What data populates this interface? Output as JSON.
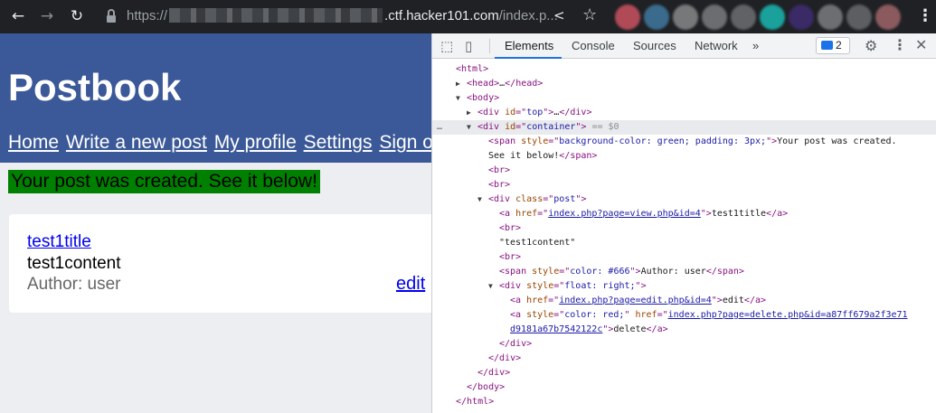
{
  "browser": {
    "url_prefix": "https://",
    "url_host": ".ctf.hacker101.com",
    "url_path": "/index.p..."
  },
  "page": {
    "site_title": "Postbook",
    "nav": [
      "Home",
      "Write a new post",
      "My profile",
      "Settings",
      "Sign out"
    ],
    "flash": "Your post was created. See it below!",
    "post": {
      "title": "test1title",
      "content": "test1content",
      "author": "Author: user",
      "edit": "edit"
    }
  },
  "devtools": {
    "tabs": [
      "Elements",
      "Console",
      "Sources",
      "Network"
    ],
    "active_tab": "Elements",
    "more_tabs": "»",
    "issues_count": "2",
    "selected_marker": "== $0",
    "dom": [
      {
        "indent": 0,
        "tri": "",
        "parts": [
          [
            "t",
            "<html>"
          ]
        ]
      },
      {
        "indent": 1,
        "tri": "▶",
        "parts": [
          [
            "t",
            "<head>"
          ],
          [
            "x",
            "…"
          ],
          [
            "t",
            "</head>"
          ]
        ]
      },
      {
        "indent": 1,
        "tri": "▼",
        "parts": [
          [
            "t",
            "<body>"
          ]
        ]
      },
      {
        "indent": 2,
        "tri": "▶",
        "parts": [
          [
            "t",
            "<div "
          ],
          [
            "an",
            "id"
          ],
          [
            "t",
            "=\""
          ],
          [
            "av",
            "top"
          ],
          [
            "t",
            "\">"
          ],
          [
            "x",
            "…"
          ],
          [
            "t",
            "</div>"
          ]
        ]
      },
      {
        "indent": 2,
        "tri": "▼",
        "sel": true,
        "parts": [
          [
            "t",
            "<div "
          ],
          [
            "an",
            "id"
          ],
          [
            "t",
            "=\""
          ],
          [
            "av",
            "container"
          ],
          [
            "t",
            "\">"
          ],
          [
            "eq",
            " == $0"
          ]
        ]
      },
      {
        "indent": 3,
        "tri": "",
        "parts": [
          [
            "t",
            "<span "
          ],
          [
            "an",
            "style"
          ],
          [
            "t",
            "=\""
          ],
          [
            "av",
            "background-color: green; padding: 3px;"
          ],
          [
            "t",
            "\">"
          ],
          [
            "x",
            "Your post was created."
          ]
        ]
      },
      {
        "indent": 3,
        "tri": "",
        "parts": [
          [
            "x",
            "See it below!"
          ],
          [
            "t",
            "</span>"
          ]
        ]
      },
      {
        "indent": 3,
        "tri": "",
        "parts": [
          [
            "t",
            "<br>"
          ]
        ]
      },
      {
        "indent": 3,
        "tri": "",
        "parts": [
          [
            "t",
            "<br>"
          ]
        ]
      },
      {
        "indent": 3,
        "tri": "▼",
        "parts": [
          [
            "t",
            "<div "
          ],
          [
            "an",
            "class"
          ],
          [
            "t",
            "=\""
          ],
          [
            "av",
            "post"
          ],
          [
            "t",
            "\">"
          ]
        ]
      },
      {
        "indent": 4,
        "tri": "",
        "parts": [
          [
            "t",
            "<a "
          ],
          [
            "an",
            "href"
          ],
          [
            "t",
            "=\""
          ],
          [
            "lnk",
            "index.php?page=view.php&id=4"
          ],
          [
            "t",
            "\">"
          ],
          [
            "x",
            "test1title"
          ],
          [
            "t",
            "</a>"
          ]
        ]
      },
      {
        "indent": 4,
        "tri": "",
        "parts": [
          [
            "t",
            "<br>"
          ]
        ]
      },
      {
        "indent": 4,
        "tri": "",
        "parts": [
          [
            "x",
            "\"test1content\""
          ]
        ]
      },
      {
        "indent": 4,
        "tri": "",
        "parts": [
          [
            "t",
            "<br>"
          ]
        ]
      },
      {
        "indent": 4,
        "tri": "",
        "parts": [
          [
            "t",
            "<span "
          ],
          [
            "an",
            "style"
          ],
          [
            "t",
            "=\""
          ],
          [
            "av",
            "color: #666"
          ],
          [
            "t",
            "\">"
          ],
          [
            "x",
            "Author: user"
          ],
          [
            "t",
            "</span>"
          ]
        ]
      },
      {
        "indent": 4,
        "tri": "▼",
        "parts": [
          [
            "t",
            "<div "
          ],
          [
            "an",
            "style"
          ],
          [
            "t",
            "=\""
          ],
          [
            "av",
            "float: right;"
          ],
          [
            "t",
            "\">"
          ]
        ]
      },
      {
        "indent": 5,
        "tri": "",
        "parts": [
          [
            "t",
            "<a "
          ],
          [
            "an",
            "href"
          ],
          [
            "t",
            "=\""
          ],
          [
            "lnk",
            "index.php?page=edit.php&id=4"
          ],
          [
            "t",
            "\">"
          ],
          [
            "x",
            "edit"
          ],
          [
            "t",
            "</a>"
          ]
        ]
      },
      {
        "indent": 5,
        "tri": "",
        "parts": [
          [
            "t",
            "<a "
          ],
          [
            "an",
            "style"
          ],
          [
            "t",
            "=\""
          ],
          [
            "av",
            "color: red;"
          ],
          [
            "t",
            "\" "
          ],
          [
            "an",
            "href"
          ],
          [
            "t",
            "=\""
          ],
          [
            "lnk",
            "index.php?page=delete.php&id=a87ff679a2f3e71"
          ]
        ]
      },
      {
        "indent": 5,
        "tri": "",
        "parts": [
          [
            "lnk",
            "d9181a67b7542122c"
          ],
          [
            "t",
            "\">"
          ],
          [
            "x",
            "delete"
          ],
          [
            "t",
            "</a>"
          ]
        ]
      },
      {
        "indent": 4,
        "tri": "",
        "parts": [
          [
            "t",
            "</div>"
          ]
        ]
      },
      {
        "indent": 3,
        "tri": "",
        "parts": [
          [
            "t",
            "</div>"
          ]
        ]
      },
      {
        "indent": 2,
        "tri": "",
        "parts": [
          [
            "t",
            "</div>"
          ]
        ]
      },
      {
        "indent": 1,
        "tri": "",
        "parts": [
          [
            "t",
            "</body>"
          ]
        ]
      },
      {
        "indent": 0,
        "tri": "",
        "parts": [
          [
            "t",
            "</html>"
          ]
        ]
      }
    ]
  }
}
